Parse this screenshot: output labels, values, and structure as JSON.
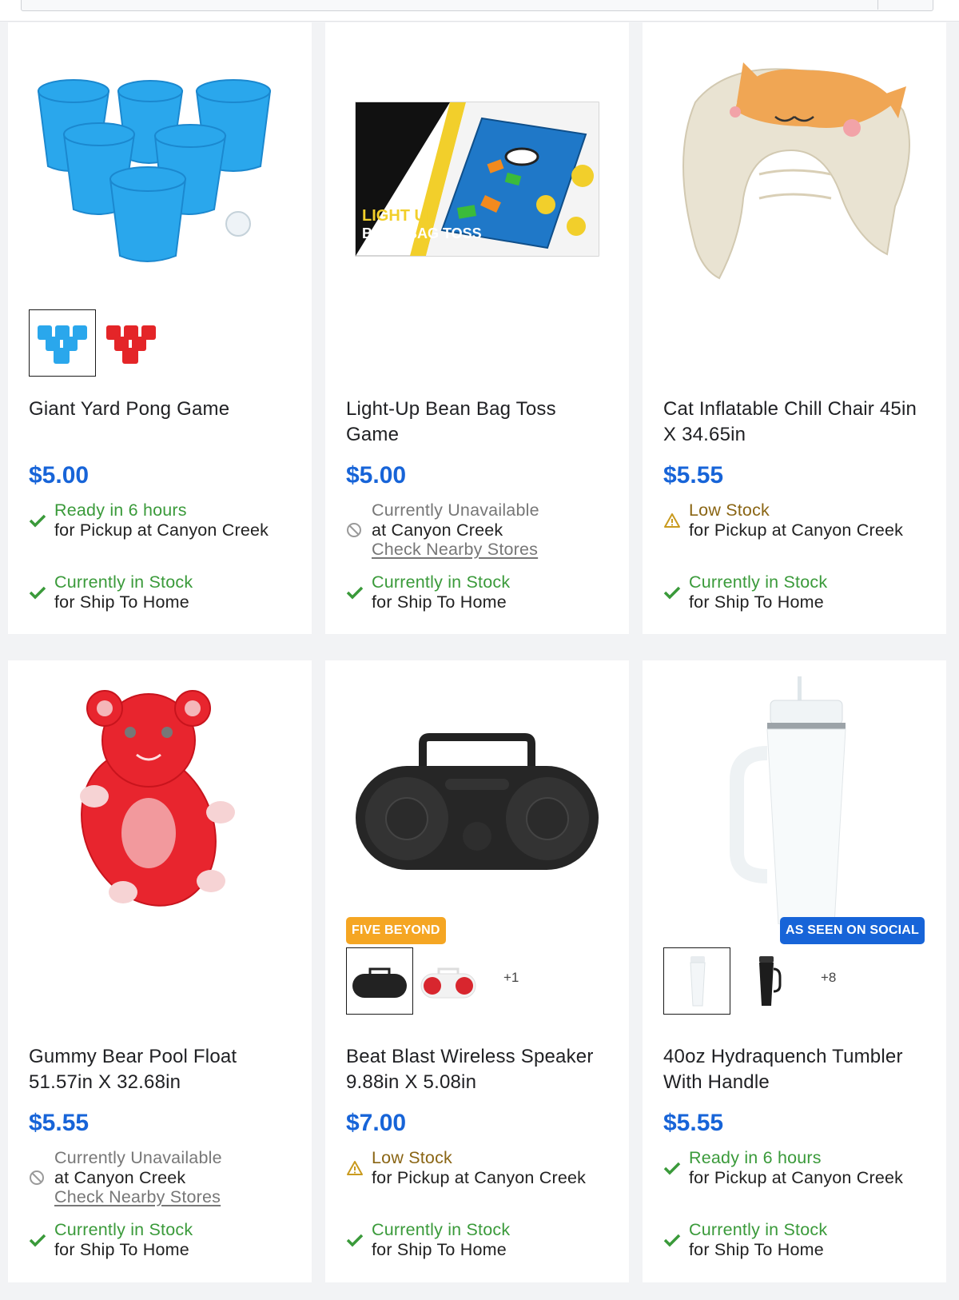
{
  "products": [
    {
      "title": "Giant Yard Pong Game",
      "price": "$5.00",
      "swatch_more": "",
      "badge": "",
      "pickup": {
        "status": "Ready in 6 hours",
        "detail": "for Pickup at Canyon Creek",
        "link": "",
        "state": "ok"
      },
      "ship": {
        "status": "Currently in Stock",
        "detail": "for Ship To Home"
      }
    },
    {
      "title": "Light-Up Bean Bag Toss Game",
      "price": "$5.00",
      "swatch_more": "",
      "badge": "",
      "box_text": {
        "line1": "LIGHT UP",
        "line2": "BEAN BAG TOSS"
      },
      "pickup": {
        "status": "Currently Unavailable",
        "detail": "at Canyon Creek",
        "link": "Check Nearby Stores",
        "state": "na"
      },
      "ship": {
        "status": "Currently in Stock",
        "detail": "for Ship To Home"
      }
    },
    {
      "title": "Cat Inflatable Chill Chair 45in X 34.65in",
      "price": "$5.55",
      "swatch_more": "",
      "badge": "",
      "pickup": {
        "status": "Low Stock",
        "detail": "for Pickup at Canyon Creek",
        "link": "",
        "state": "low"
      },
      "ship": {
        "status": "Currently in Stock",
        "detail": "for Ship To Home"
      }
    },
    {
      "title": "Gummy Bear Pool Float 51.57in X 32.68in",
      "price": "$5.55",
      "swatch_more": "",
      "badge": "",
      "pickup": {
        "status": "Currently Unavailable",
        "detail": "at Canyon Creek",
        "link": "Check Nearby Stores",
        "state": "na"
      },
      "ship": {
        "status": "Currently in Stock",
        "detail": "for Ship To Home"
      }
    },
    {
      "title": "Beat Blast Wireless Speaker 9.88in X 5.08in",
      "price": "$7.00",
      "swatch_more": "+1",
      "badge": "FIVE BEYOND",
      "pickup": {
        "status": "Low Stock",
        "detail": "for Pickup at Canyon Creek",
        "link": "",
        "state": "low"
      },
      "ship": {
        "status": "Currently in Stock",
        "detail": "for Ship To Home"
      }
    },
    {
      "title": "40oz Hydraquench Tumbler With Handle",
      "price": "$5.55",
      "swatch_more": "+8",
      "badge": "AS SEEN ON SOCIAL",
      "pickup": {
        "status": "Ready in 6 hours",
        "detail": "for Pickup at Canyon Creek",
        "link": "",
        "state": "ok"
      },
      "ship": {
        "status": "Currently in Stock",
        "detail": "for Ship To Home"
      }
    }
  ],
  "colors": {
    "price": "#1764d8",
    "in_stock": "#3a9a3a",
    "low_stock": "#8a6514",
    "badge_orange": "#f5a623",
    "badge_blue": "#1764d8"
  },
  "icons": {
    "ok": "check-icon",
    "low": "warning-icon",
    "na": "unavailable-icon"
  }
}
